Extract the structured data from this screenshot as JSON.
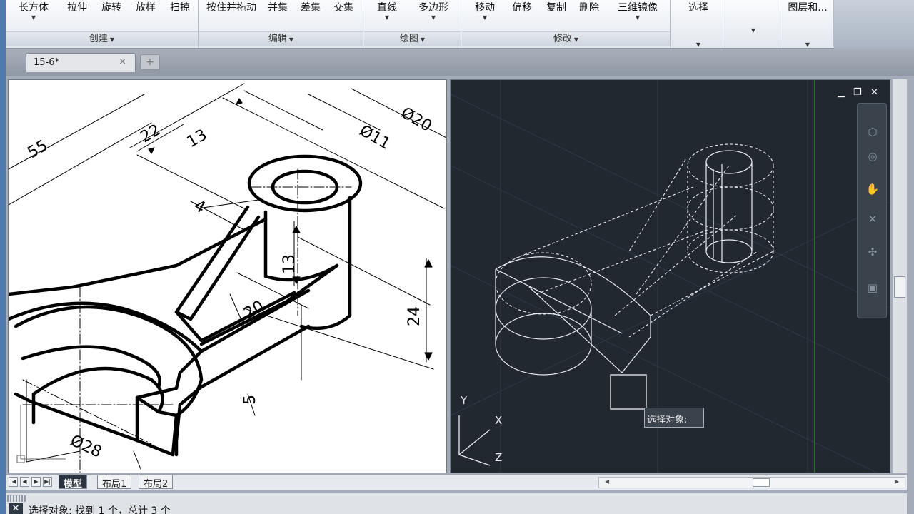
{
  "ribbon": {
    "panels": [
      {
        "title": "创建",
        "buttons": [
          "长方体",
          "拉伸",
          "旋转",
          "放样",
          "扫掠"
        ]
      },
      {
        "title": "编辑",
        "buttons": [
          "按住并拖动",
          "并集",
          "差集",
          "交集"
        ]
      },
      {
        "title": "绘图",
        "buttons": [
          "直线",
          "多边形"
        ]
      },
      {
        "title": "修改",
        "buttons": [
          "移动",
          "偏移",
          "复制",
          "删除",
          "三维镜像"
        ]
      },
      {
        "title": "",
        "buttons": [
          "选择"
        ]
      },
      {
        "title": "",
        "buttons": [
          ""
        ]
      },
      {
        "title": "",
        "buttons": [
          "图层和..."
        ]
      }
    ],
    "dropdown_glyph": "▼"
  },
  "doc_tab": {
    "label": "15-6*",
    "close": "×",
    "new_tab_glyph": "+"
  },
  "viewports": {
    "left": {
      "dimensions": [
        "55",
        "22",
        "Ø20",
        "13",
        "Ø11",
        "4",
        "13",
        "24",
        "20",
        "5",
        "Ø28"
      ]
    },
    "right": {
      "controls": {
        "minimize": "▁",
        "restore": "❐",
        "close": "✕"
      },
      "ucs": {
        "y": "Y",
        "x": "X",
        "z": "Z"
      },
      "tooltip": "选择对象:"
    }
  },
  "layout_tabs": {
    "nav": [
      "|◀",
      "◀",
      "▶",
      "▶|"
    ],
    "tabs": [
      {
        "label": "模型",
        "active": true
      },
      {
        "label": "布局1",
        "active": false
      },
      {
        "label": "布局2",
        "active": false
      }
    ]
  },
  "command_line": {
    "text": "选择对象: 找到 1 个，总计 3 个",
    "close": "✕"
  },
  "colors": {
    "accent": "#4d79ad",
    "model_bg": "#212830",
    "paper_bg": "#ffffff"
  }
}
